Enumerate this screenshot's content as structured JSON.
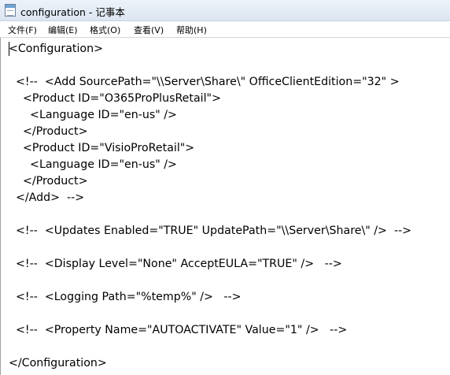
{
  "window": {
    "title": "configuration - 记事本"
  },
  "menu": [
    {
      "label": "文件(F)"
    },
    {
      "label": "编辑(E)"
    },
    {
      "label": "格式(O)"
    },
    {
      "label": "查看(V)"
    },
    {
      "label": "帮助(H)"
    }
  ],
  "editor": {
    "lines": [
      "<Configuration>",
      "",
      "  <!--  <Add SourcePath=\"\\\\Server\\Share\\\" OfficeClientEdition=\"32\" >",
      "    <Product ID=\"O365ProPlusRetail\">",
      "      <Language ID=\"en-us\" />",
      "    </Product>",
      "    <Product ID=\"VisioProRetail\">",
      "      <Language ID=\"en-us\" />",
      "    </Product>",
      "  </Add>  -->",
      "",
      "  <!--  <Updates Enabled=\"TRUE\" UpdatePath=\"\\\\Server\\Share\\\" />  -->",
      "",
      "  <!--  <Display Level=\"None\" AcceptEULA=\"TRUE\" />   -->",
      "",
      "  <!--  <Logging Path=\"%temp%\" />   -->",
      "",
      "  <!--  <Property Name=\"AUTOACTIVATE\" Value=\"1\" />   -->",
      "",
      "</Configuration>"
    ]
  }
}
